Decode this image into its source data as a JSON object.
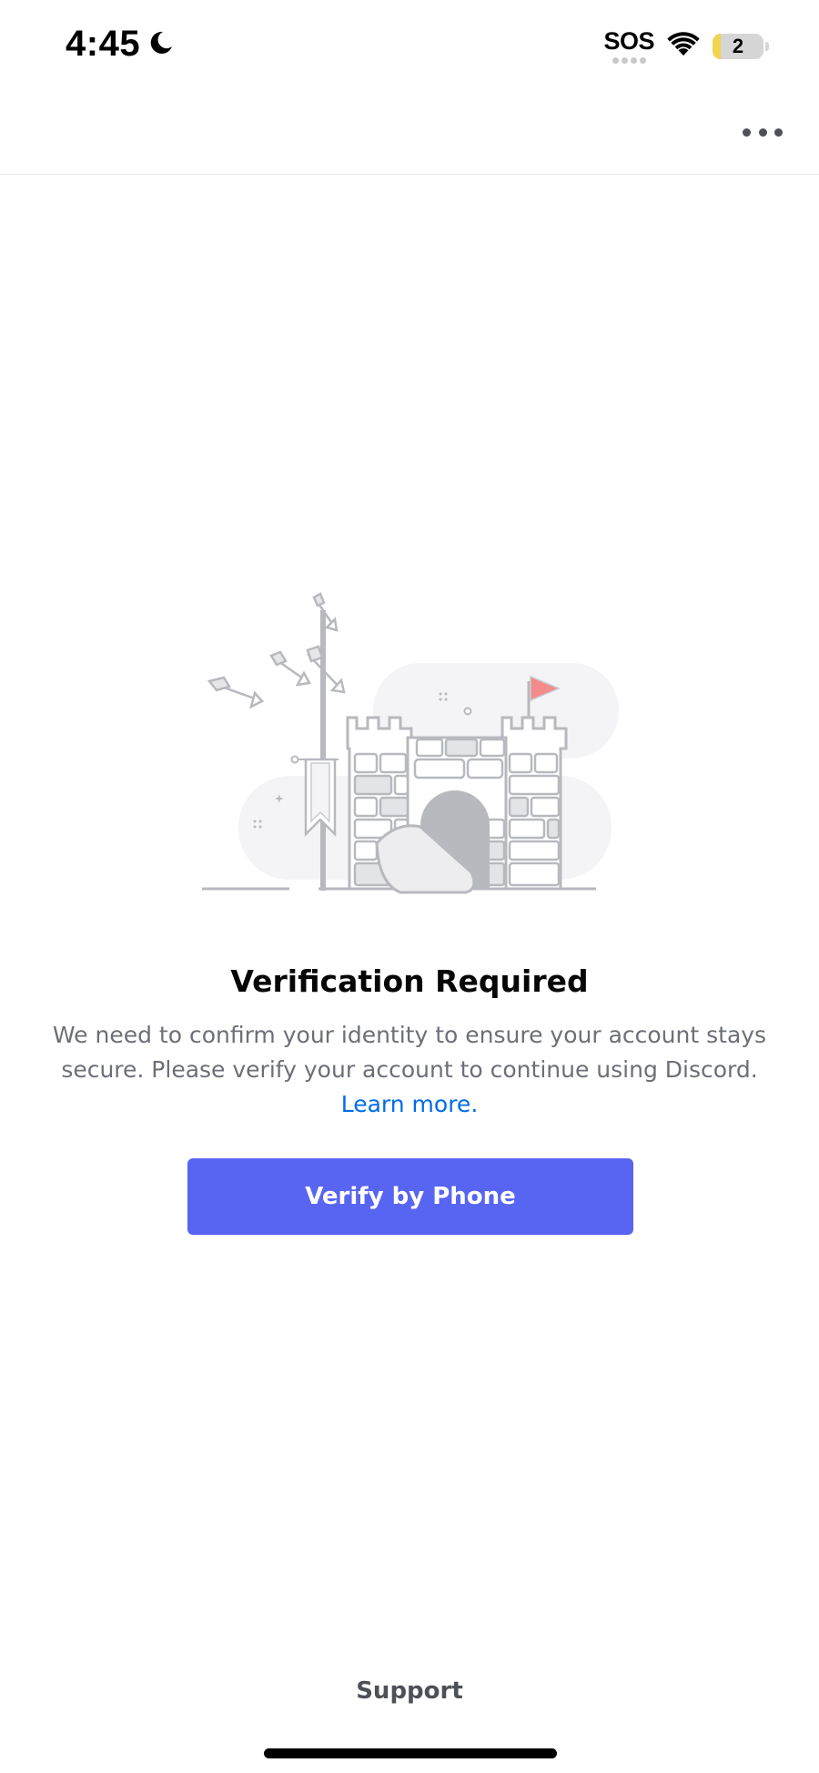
{
  "status_bar": {
    "time": "4:45",
    "carrier_status": "SOS",
    "battery_level": "2"
  },
  "icons": {
    "moon": "moon-icon",
    "wifi": "wifi-icon",
    "more": "more-horizontal-icon"
  },
  "main": {
    "title": "Verification Required",
    "description": "We need to confirm your identity to ensure your account stays secure. Please verify your account to continue using Discord.",
    "learn_more": "Learn more.",
    "verify_button": "Verify by Phone"
  },
  "footer": {
    "support": "Support"
  },
  "colors": {
    "brand_blurple": "#5865f2",
    "link": "#006ce7",
    "flag": "#f38b8b"
  }
}
